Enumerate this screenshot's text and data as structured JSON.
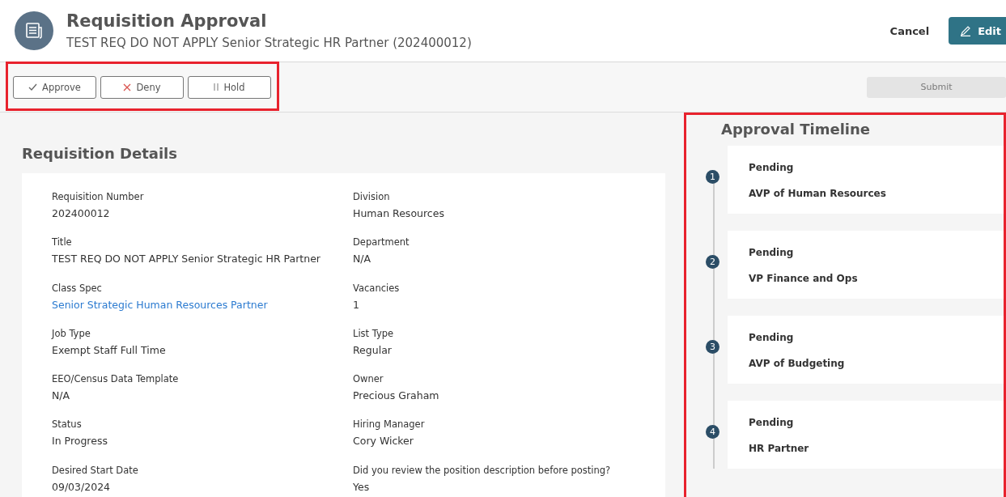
{
  "header": {
    "title": "Requisition Approval",
    "subtitle": "TEST REQ DO NOT APPLY Senior Strategic HR Partner (202400012)",
    "cancel": "Cancel",
    "edit": "Edit"
  },
  "actions": {
    "highlighted": true,
    "buttons": [
      {
        "kind": "approve",
        "label": "Approve"
      },
      {
        "kind": "deny",
        "label": "Deny"
      },
      {
        "kind": "hold",
        "label": "Hold"
      }
    ],
    "submit": {
      "label": "Submit",
      "disabled": true
    }
  },
  "details": {
    "title": "Requisition Details",
    "fields": [
      {
        "label": "Requisition Number",
        "value": "202400012",
        "kind": "text"
      },
      {
        "label": "Division",
        "value": "Human Resources",
        "kind": "text"
      },
      {
        "label": "Title",
        "value": "TEST REQ DO NOT APPLY Senior Strategic HR Partner",
        "kind": "text"
      },
      {
        "label": "Department",
        "value": "N/A",
        "kind": "text"
      },
      {
        "label": "Class Spec",
        "value": "Senior Strategic Human Resources Partner",
        "kind": "link"
      },
      {
        "label": "Vacancies",
        "value": "1",
        "kind": "text"
      },
      {
        "label": "Job Type",
        "value": "Exempt Staff Full Time",
        "kind": "text"
      },
      {
        "label": "List Type",
        "value": "Regular",
        "kind": "text"
      },
      {
        "label": "EEO/Census Data Template",
        "value": "N/A",
        "kind": "text"
      },
      {
        "label": "Owner",
        "value": "Precious Graham",
        "kind": "text"
      },
      {
        "label": "Status",
        "value": "In Progress",
        "kind": "text"
      },
      {
        "label": "Hiring Manager",
        "value": "Cory Wicker",
        "kind": "text"
      },
      {
        "label": "Desired Start Date",
        "value": "09/03/2024",
        "kind": "text"
      },
      {
        "label": "Did you review the position description before posting?",
        "value": "Yes",
        "kind": "text"
      }
    ]
  },
  "timeline": {
    "title": "Approval Timeline",
    "highlighted": true,
    "steps": [
      {
        "number": "1",
        "status": "Pending",
        "approver": "AVP of Human Resources"
      },
      {
        "number": "2",
        "status": "Pending",
        "approver": "VP Finance and Ops"
      },
      {
        "number": "3",
        "status": "Pending",
        "approver": "AVP of Budgeting"
      },
      {
        "number": "4",
        "status": "Pending",
        "approver": "HR Partner"
      }
    ]
  }
}
